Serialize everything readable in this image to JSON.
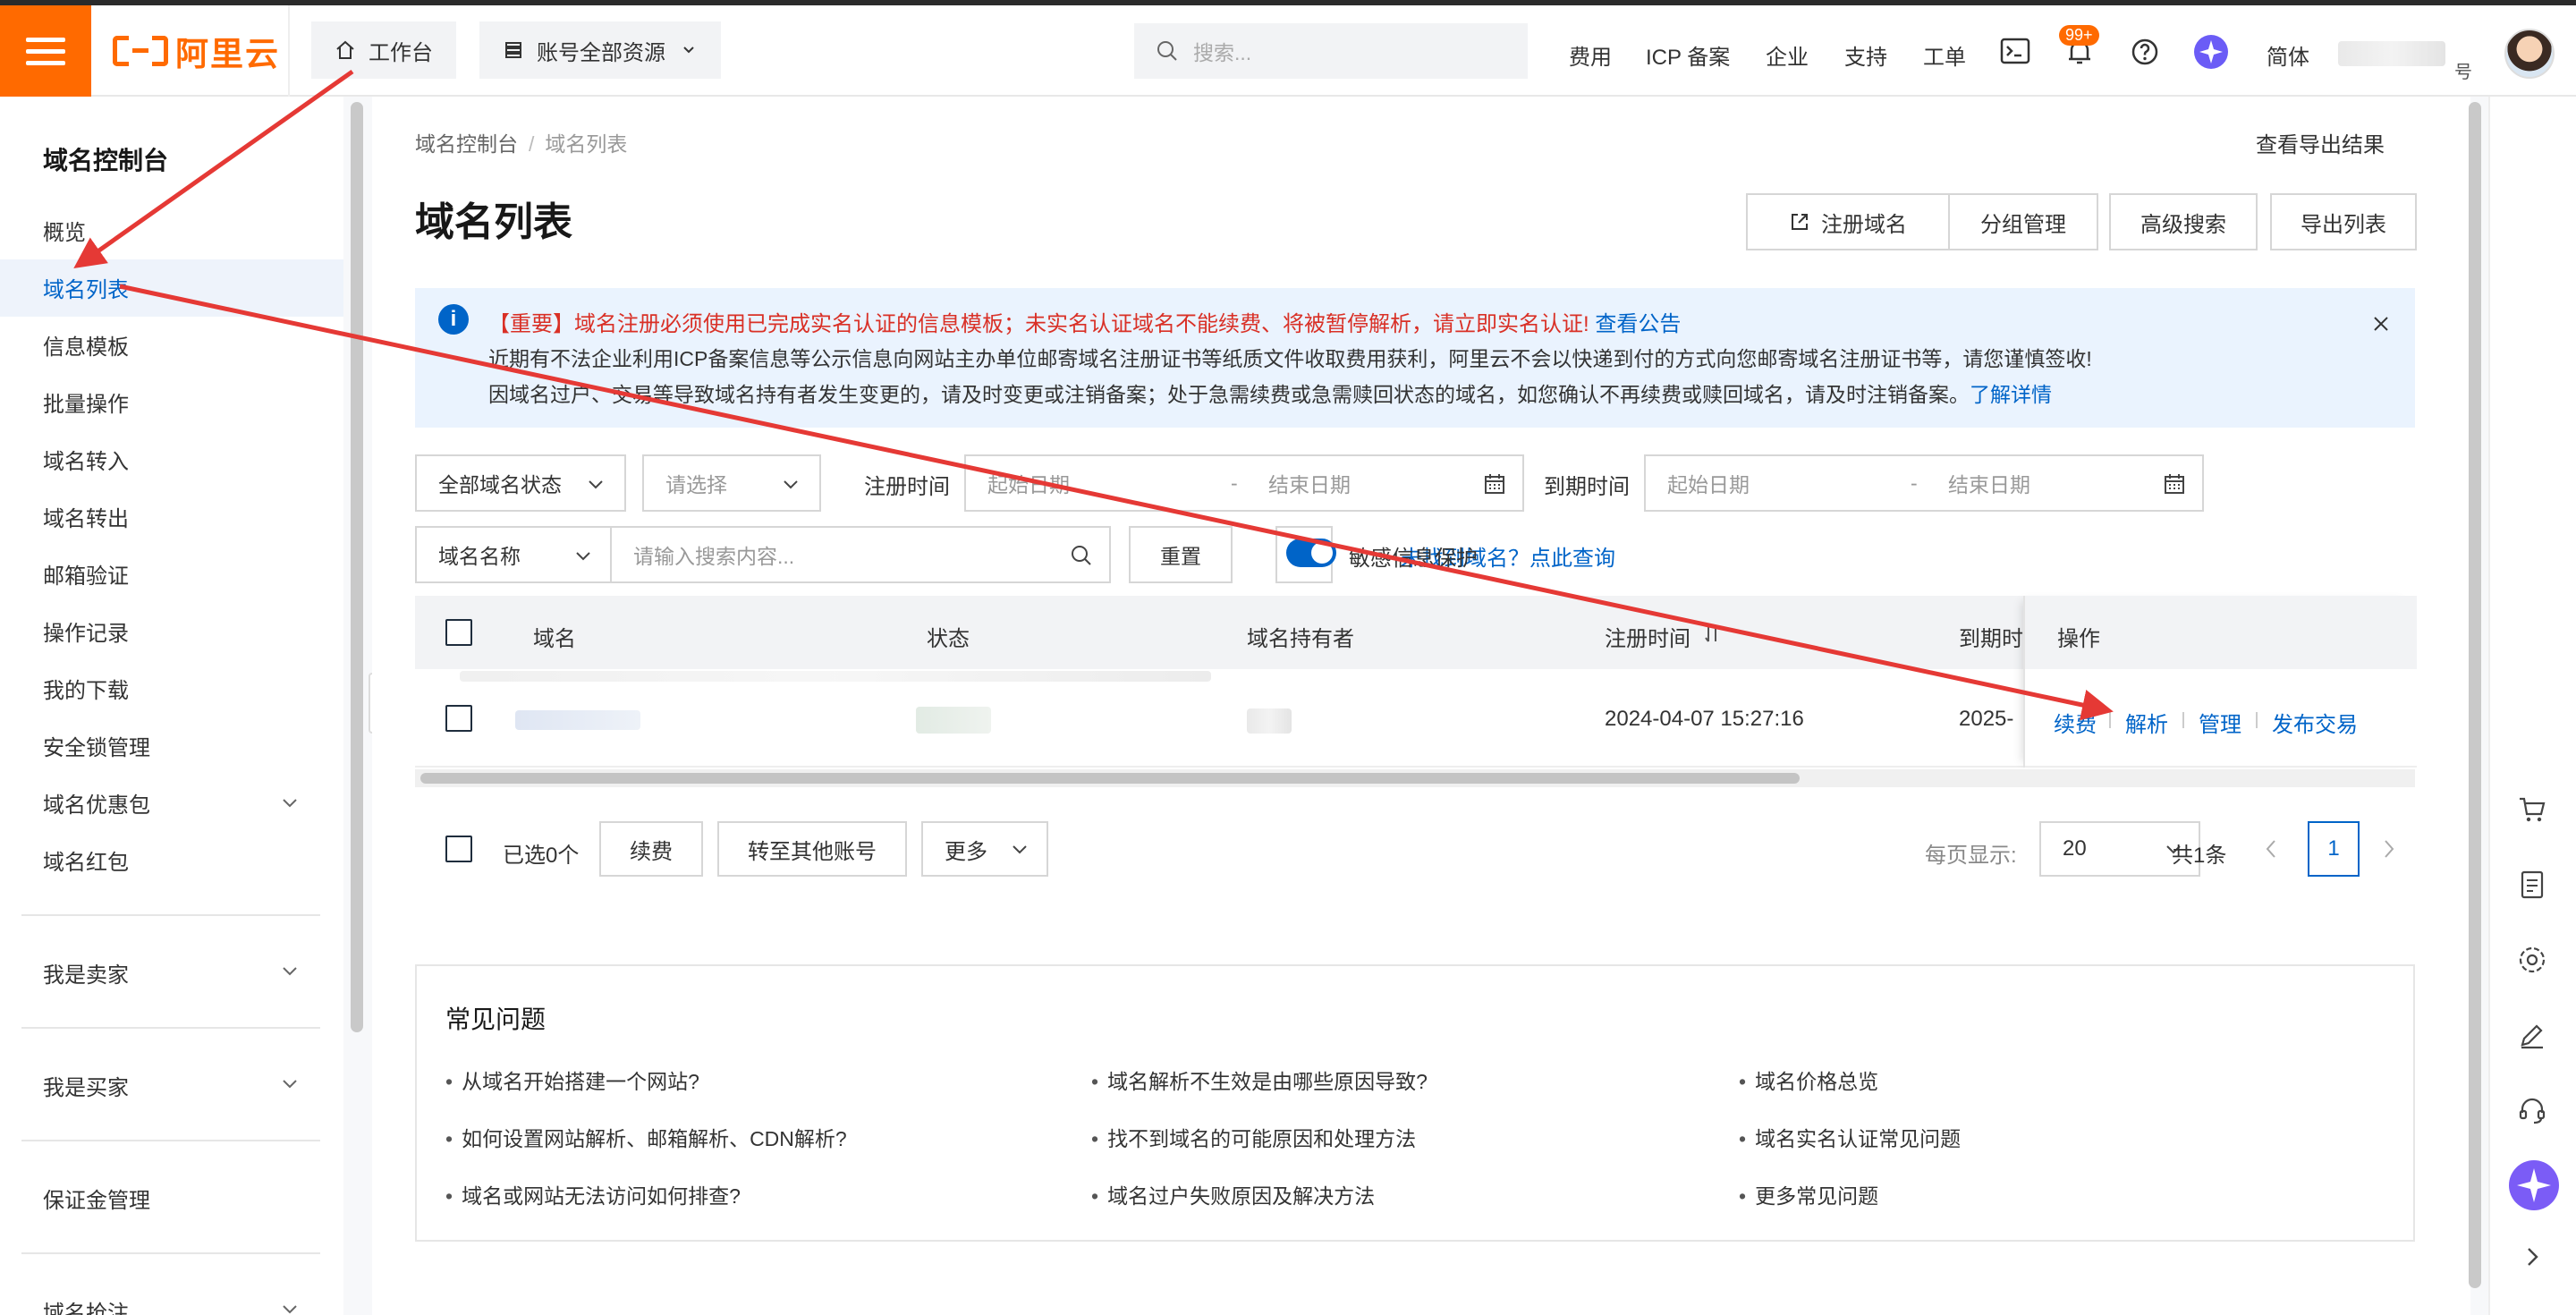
{
  "header": {
    "logo_text": "阿里云",
    "workbench": "工作台",
    "resources": "账号全部资源",
    "search_placeholder": "搜索...",
    "nav": [
      "费用",
      "ICP 备案",
      "企业",
      "支持",
      "工单"
    ],
    "badge": "99+",
    "lang": "简体",
    "account_suffix": "号"
  },
  "sidebar": {
    "title": "域名控制台",
    "items": [
      "概览",
      "域名列表",
      "信息模板",
      "批量操作",
      "域名转入",
      "域名转出",
      "邮箱验证",
      "操作记录",
      "我的下载",
      "安全锁管理",
      "域名优惠包",
      "域名红包"
    ],
    "groups": [
      "我是卖家",
      "我是买家",
      "保证金管理",
      "域名抢注"
    ]
  },
  "main": {
    "breadcrumb": [
      "域名控制台",
      "域名列表"
    ],
    "export_results": "查看导出结果",
    "title": "域名列表",
    "buttons": [
      "注册域名",
      "分组管理",
      "高级搜索",
      "导出列表"
    ],
    "notice": {
      "line1": "【重要】域名注册必须使用已完成实名认证的信息模板；未实名认证域名不能续费、将被暂停解析，请立即实名认证!",
      "line1_link": "查看公告",
      "line2": "近期有不法企业利用ICP备案信息等公示信息向网站主办单位邮寄域名注册证书等纸质文件收取费用获利，阿里云不会以快递到付的方式向您邮寄域名注册证书等，请您谨慎签收!",
      "line3": "因域名过户、交易等导致域名持有者发生变更的，请及时变更或注销备案；处于急需续费或急需赎回状态的域名，如您确认不再续费或赎回域名，请及时注销备案。",
      "line3_link": "了解详情"
    },
    "filters": {
      "status": "全部域名状态",
      "select": "请选择",
      "reg_label": "注册时间",
      "exp_label": "到期时间",
      "start_ph": "起始日期",
      "end_ph": "结束日期",
      "dash": "-",
      "name_type": "域名名称",
      "search_ph": "请输入搜索内容...",
      "reset": "重置",
      "not_found": "未找到域名？点此查询",
      "sensitive": "敏感信息保护"
    },
    "table": {
      "headers": [
        "域名",
        "状态",
        "域名持有者",
        "注册时间",
        "到期时",
        "操作"
      ],
      "row": {
        "reg_time": "2024-04-07 15:27:16",
        "exp_time": "2025-"
      },
      "ops": [
        "续费",
        "解析",
        "管理",
        "发布交易"
      ]
    },
    "bulk": {
      "selected": "已选0个",
      "renew": "续费",
      "transfer": "转至其他账号",
      "more": "更多"
    },
    "pager": {
      "per_page_label": "每页显示:",
      "per_page": "20",
      "total": "共1条",
      "page": "1"
    },
    "faq": {
      "title": "常见问题",
      "items": [
        "从域名开始搭建一个网站?",
        "域名解析不生效是由哪些原因导致?",
        "域名价格总览",
        "如何设置网站解析、邮箱解析、CDN解析?",
        "找不到域名的可能原因和处理方法",
        "域名实名认证常见问题",
        "域名或网站无法访问如何排查?",
        "域名过户失败原因及解决方法",
        "更多常见问题"
      ]
    }
  },
  "colors": {
    "accent": "#ff6a00",
    "link": "#0064c8",
    "danger": "#d93026",
    "arrow": "#e53935"
  }
}
